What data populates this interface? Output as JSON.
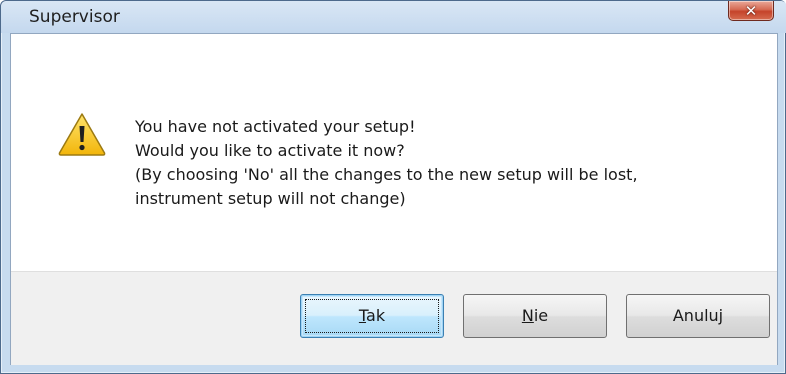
{
  "window": {
    "title": "Supervisor",
    "close_glyph": "✕",
    "close_icon": "close-icon"
  },
  "message": {
    "icon": "warning-icon",
    "lines": [
      "You have not activated your setup!",
      "Would you like to activate it now?",
      "(By choosing 'No' all the changes to the new setup will be lost,",
      "instrument setup will not change)"
    ]
  },
  "buttons": {
    "yes": {
      "mnemonic": "T",
      "rest": "ak"
    },
    "no": {
      "mnemonic": "N",
      "rest": "ie"
    },
    "cancel": {
      "label": "Anuluj"
    }
  },
  "colors": {
    "titlebar": "#c4d8ee",
    "close_button": "#c5432a",
    "default_button_border": "#3c7fb1"
  }
}
